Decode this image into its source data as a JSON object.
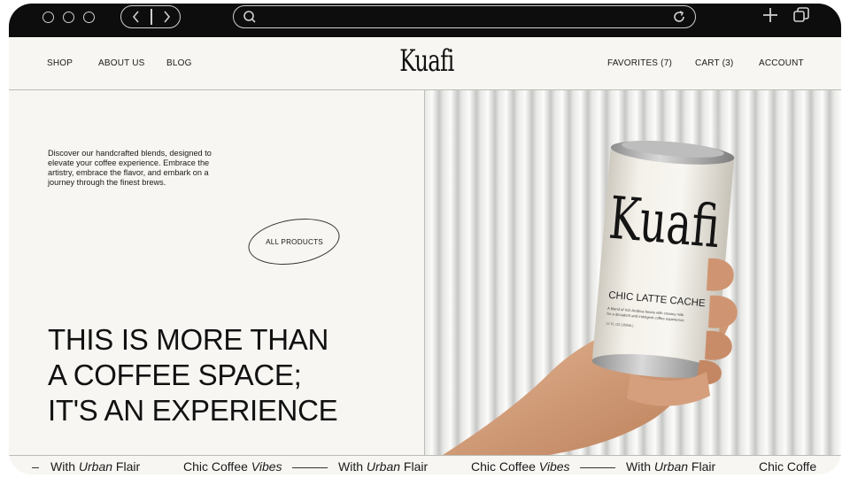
{
  "browser": {
    "url": "",
    "icons": [
      "window-dot-icon",
      "back-icon",
      "forward-icon",
      "search-icon",
      "reload-icon",
      "new-tab-icon",
      "tabs-icon"
    ]
  },
  "nav": {
    "left": [
      "SHOP",
      "ABOUT US",
      "BLOG"
    ],
    "logo": "Kuafi",
    "right": [
      "FAVORITES (7)",
      "CART (3)",
      "ACCOUNT"
    ]
  },
  "intro": "Discover our handcrafted blends, designed to elevate your coffee experience. Embrace the artistry, embrace the flavor, and embark on a journey through the finest brews.",
  "cta": "ALL PRODUCTS",
  "headline": [
    "THIS IS MORE THAN",
    "A COFFEE SPACE;",
    "IT'S AN EXPERIENCE"
  ],
  "can": {
    "brand": "Kuafi",
    "flavor": "CHIC LATTE CACHE",
    "desc_1": "A blend of rich Arabica beans with creamy milk",
    "desc_2": "for a decadent and indulgent coffee experience.",
    "volume": "12 FL OZ (355ML)"
  },
  "marquee": {
    "p1a": "With ",
    "p1b": "Urban",
    "p1c": " Flair",
    "p2a": "Chic Coffee ",
    "p2b": "Vibes",
    "p3a": "With ",
    "p3b": "Urban",
    "p3c": " Flair",
    "p4a": "Chic Coffee ",
    "p4b": "Vibes",
    "p5a": "With ",
    "p5b": "Urban",
    "p5c": " Flair",
    "p6a": "Chic Coffe"
  },
  "colors": {
    "background": "#f7f6f2",
    "text": "#1a1a1a",
    "chrome": "#0d0d0d"
  }
}
